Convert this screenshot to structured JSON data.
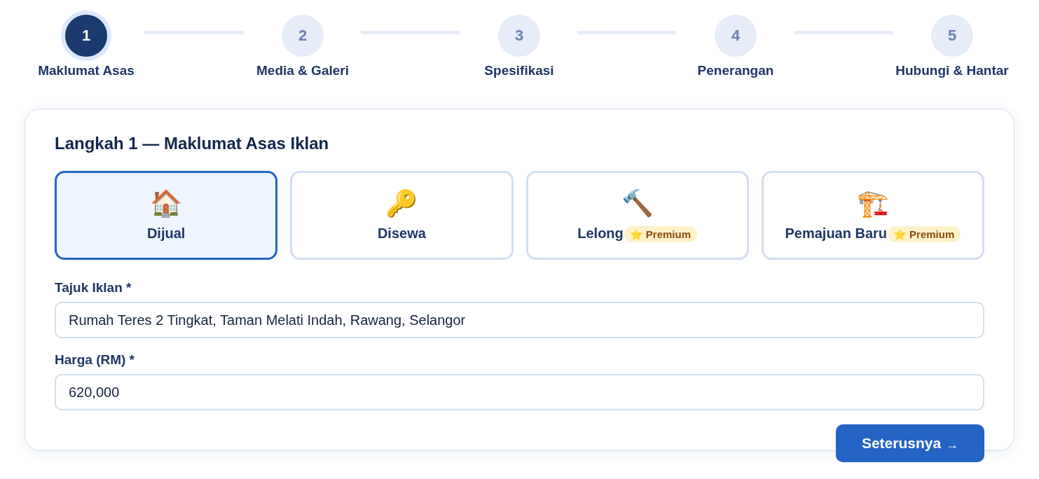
{
  "steps": [
    {
      "number": "1",
      "label": "Maklumat Asas",
      "current": true
    },
    {
      "number": "2",
      "label": "Media & Galeri",
      "current": false
    },
    {
      "number": "3",
      "label": "Spesifikasi",
      "current": false
    },
    {
      "number": "4",
      "label": "Penerangan",
      "current": false
    },
    {
      "number": "5",
      "label": "Hubungi & Hantar",
      "current": false
    }
  ],
  "form": {
    "title": "Langkah 1 — Maklumat Asas Iklan",
    "listing_types": [
      {
        "icon": "🏠",
        "label": "Dijual",
        "selected": true
      },
      {
        "icon": "🔑",
        "label": "Disewa",
        "selected": false
      },
      {
        "icon": "🔨",
        "label": "Lelong",
        "selected": false,
        "badge": {
          "icon": "⭐",
          "label": "Premium"
        }
      },
      {
        "icon": "🏗️",
        "label": "Pemajuan Baru",
        "selected": false,
        "badge": {
          "icon": "⭐",
          "label": "Premium"
        }
      }
    ],
    "fields": [
      {
        "label": "Tajuk Iklan *",
        "value": "Rumah Teres 2 Tingkat, Taman Melati Indah, Rawang, Selangor"
      },
      {
        "label": "Harga (RM) *",
        "value": "620,000"
      }
    ],
    "next_button": {
      "label": "Seterusnya",
      "arrow": "→"
    }
  }
}
